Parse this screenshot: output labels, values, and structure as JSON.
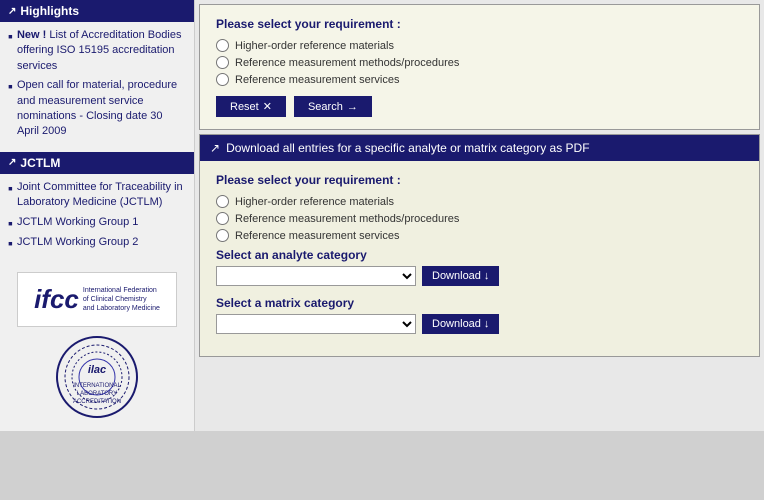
{
  "sidebar": {
    "highlights_header": "Highlights",
    "items": [
      {
        "text": "New ! List of Accreditation Bodies offering ISO 15195 accreditation services",
        "closing": false
      },
      {
        "text": "Open call for material, procedure and measurement service nominations - Closing date 30 April 2009",
        "closing": true
      }
    ],
    "jctlm_header": "JCTLM",
    "jctlm_items": [
      {
        "text": "Joint Committee for Traceability in Laboratory Medicine (JCTLM)"
      },
      {
        "text": "JCTLM Working Group 1"
      },
      {
        "text": "JCTLM Working Group 2"
      }
    ]
  },
  "search_panel": {
    "requirement_label": "Please select your requirement :",
    "options": [
      {
        "id": "r1",
        "label": "Higher-order reference materials"
      },
      {
        "id": "r2",
        "label": "Reference measurement methods/procedures"
      },
      {
        "id": "r3",
        "label": "Reference measurement services"
      }
    ],
    "reset_label": "Reset",
    "search_label": "Search"
  },
  "download_panel": {
    "header": "Download all entries for a specific analyte or matrix category as PDF",
    "requirement_label": "Please select your requirement :",
    "options": [
      {
        "id": "d1",
        "label": "Higher-order reference materials"
      },
      {
        "id": "d2",
        "label": "Reference measurement methods/procedures"
      },
      {
        "id": "d3",
        "label": "Reference measurement services"
      }
    ],
    "analyte_label": "Select an analyte category",
    "matrix_label": "Select a matrix category",
    "download_label": "Download",
    "download_arrow": "↓"
  },
  "logos": {
    "ifcc_big": "ifcc",
    "ifcc_sub": "International Federation\nof Clinical Chemistry\nand Laboratory Medicine",
    "ilac_text": "ilac"
  }
}
